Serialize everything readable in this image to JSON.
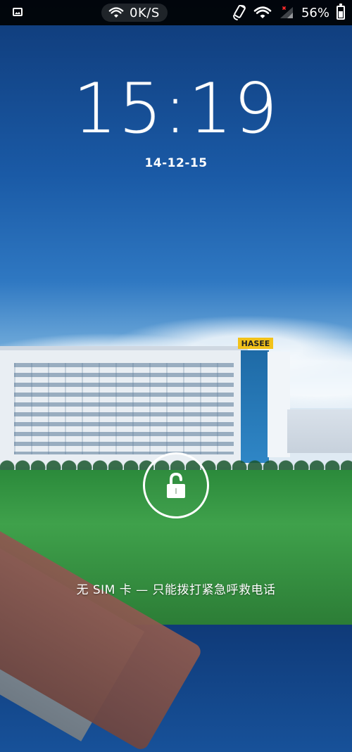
{
  "status_bar": {
    "network_speed": "0K/S",
    "battery_percent_text": "56%",
    "battery_level": 0.56,
    "icons": {
      "left": "picture-icon",
      "wifi": "wifi-icon",
      "rotation": "screen-rotation-icon",
      "wifi_right": "wifi-icon",
      "cell": "cellular-signal-icon",
      "battery": "battery-icon"
    }
  },
  "lockscreen": {
    "time": "15:19",
    "date": "14-12-15",
    "emergency_hint": "无 SIM 卡 — 只能拨打紧急呼救电话",
    "lock_icon": "lock-icon",
    "brand_sign": "HASEE"
  },
  "colors": {
    "sky_top": "#0f3a78",
    "sky_mid": "#2f78c2",
    "grass": "#3fa14b",
    "status_bg": "#000000",
    "text": "#ffffff"
  }
}
